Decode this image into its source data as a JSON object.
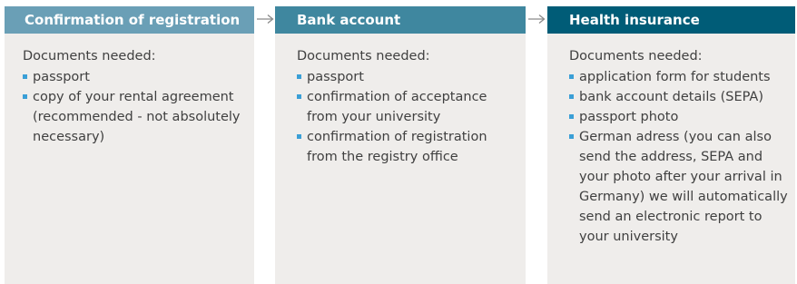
{
  "steps": [
    {
      "title": "Confirmation of registration",
      "header_color": "#6a9fb6",
      "intro": "Documents needed:",
      "items": [
        "passport",
        "copy of your rental agreement (recommended - not absolutely necessary)"
      ]
    },
    {
      "title": "Bank account",
      "header_color": "#3f879f",
      "intro": "Documents needed:",
      "items": [
        "passport",
        "confirmation of acceptance from your university",
        "confirmation of registration from the registry office"
      ]
    },
    {
      "title": "Health insurance",
      "header_color": "#005c77",
      "intro": "Documents needed:",
      "items": [
        "application form for students",
        "bank account details (SEPA)",
        "passport photo",
        "German adress (you can also send the address, SEPA and your photo after your arrival in Germany) we will automatically send an electronic report to your university"
      ]
    }
  ],
  "colors": {
    "card_background": "#efedeb",
    "body_text": "#404040",
    "bullet": "#3a9fd6",
    "arrow": "#8a8a8a"
  },
  "icons": {
    "connector": "arrow-right-icon",
    "bullet": "square-bullet-icon"
  }
}
